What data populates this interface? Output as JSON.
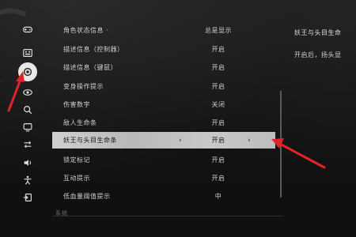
{
  "colors": {
    "accent": "#e3232a",
    "selected_row": "#c4c4c4",
    "background": "#141414"
  },
  "rail": {
    "icons": [
      "gamepad-icon",
      "keyboard-icon",
      "gear-icon",
      "eye-icon",
      "search-icon",
      "monitor-icon",
      "swap-icon",
      "speaker-icon",
      "accessibility-icon",
      "exit-icon"
    ],
    "active_index": 2
  },
  "settings": [
    {
      "label": "角色状态信息 ·",
      "value": "总是显示"
    },
    {
      "label": "描述信息（控制器）",
      "value": "开启"
    },
    {
      "label": "描述信息（键鼠）",
      "value": "开启"
    },
    {
      "label": "变身操作提示",
      "value": "开启"
    },
    {
      "label": "伤害数字",
      "value": "关闭"
    },
    {
      "label": "敌人生命条",
      "value": "开启"
    },
    {
      "label": "妖王与头目生命条",
      "value": "开启",
      "selected": true,
      "left_arrow": "‹",
      "right_arrow": "›"
    },
    {
      "label": "锁定标记",
      "value": "开启"
    },
    {
      "label": "互动提示",
      "value": "开启"
    },
    {
      "label": "低血量阈值提示",
      "value": "中"
    }
  ],
  "section_label": "系统",
  "description": {
    "title": "妖王与头目生命",
    "body": "开启后，扬头显"
  }
}
